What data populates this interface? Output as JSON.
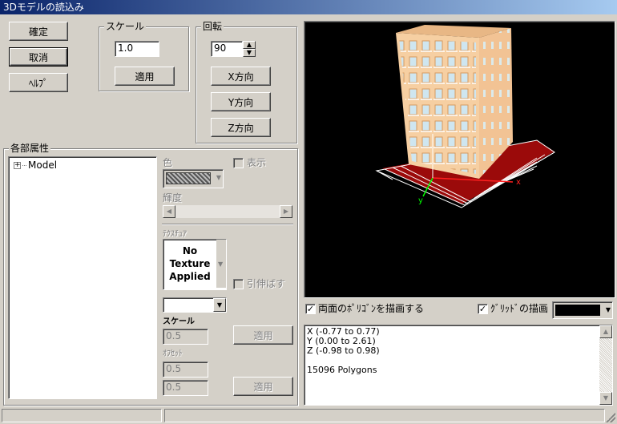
{
  "window": {
    "title": "3Dモデルの読込み"
  },
  "buttons": {
    "ok": "確定",
    "cancel": "取消",
    "help": "ﾍﾙﾌﾟ"
  },
  "scale": {
    "group_label": "スケール",
    "value": "1.0",
    "apply": "適用"
  },
  "rotation": {
    "group_label": "回転",
    "value": "90",
    "x": "X方向",
    "y": "Y方向",
    "z": "Z方向"
  },
  "attributes": {
    "group_label": "各部属性",
    "tree": [
      {
        "label": "Model",
        "expander": "+"
      }
    ],
    "color_label": "色",
    "show_label": "表示",
    "brightness_label": "輝度",
    "texture_label": "ﾃｸｽﾁｭｱ",
    "no_texture": "No\nTexture\nApplied",
    "stretch_label": "引伸ばす",
    "tex_scale_label": "スケール",
    "tex_scale_value": "0.5",
    "tex_scale_apply": "適用",
    "offset_label": "ｵﾌｾｯﾄ",
    "offset_x": "0.5",
    "offset_y": "0.5",
    "offset_apply": "適用"
  },
  "viewer": {
    "backface_label": "両面のﾎﾟﾘｺﾞﾝを描画する",
    "backface_checked": "✓",
    "grid_label": "ｸﾞﾘｯﾄﾞの描画",
    "grid_checked": "✓",
    "grid_color": "#000000",
    "axis_x": "x",
    "axis_y": "y",
    "axis_z": "z"
  },
  "info": {
    "x_range": "X (-0.77 to 0.77)",
    "y_range": "Y (0.00 to 2.61)",
    "z_range": "Z (-0.98 to 0.98)",
    "polygons": "15096 Polygons"
  },
  "colors": {
    "title_bar": "#0a246a",
    "face": "#d4d0c8",
    "viewport": "#000000",
    "building": "#f2c394",
    "ground": "#9b0a0a"
  }
}
